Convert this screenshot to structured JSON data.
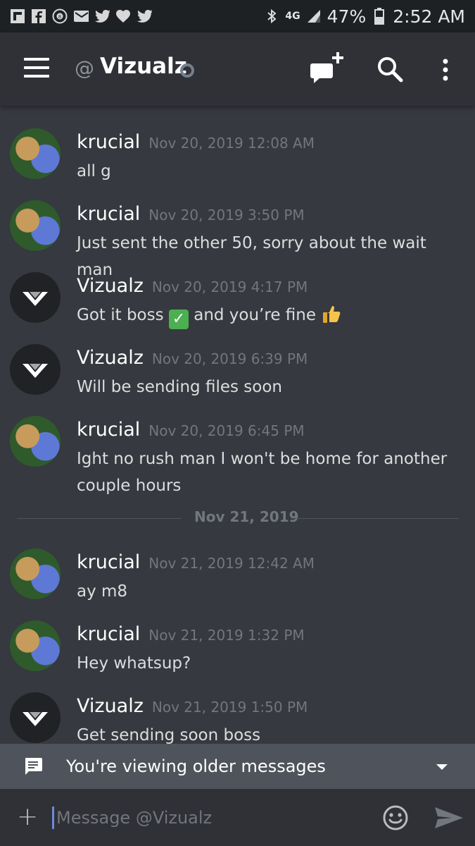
{
  "status_bar": {
    "left_icons": [
      "flipboard-icon",
      "facebook-icon",
      "8ball-icon",
      "mail-icon",
      "twitter-icon",
      "heart-icon",
      "twitter-icon"
    ],
    "network": "4G",
    "battery": "47%",
    "time": "2:52 AM"
  },
  "header": {
    "at_symbol": "@",
    "title": "Vizualz"
  },
  "messages": [
    {
      "author": "krucial",
      "timestamp": "Nov 20, 2019 12:08 AM",
      "text": "all g"
    },
    {
      "author": "krucial",
      "timestamp": "Nov 20, 2019 3:50 PM",
      "text": "Just sent the other 50, sorry about the wait man"
    },
    {
      "author": "Vizualz",
      "timestamp": "Nov 20, 2019 4:17 PM",
      "text_a": "Got it boss",
      "text_b": "and you’re fine"
    },
    {
      "author": "Vizualz",
      "timestamp": "Nov 20, 2019 6:39 PM",
      "text": "Will be sending files soon"
    },
    {
      "author": "krucial",
      "timestamp": "Nov 20, 2019 6:45 PM",
      "text": "Ight no rush man I won't be home for another couple hours"
    },
    {
      "author": "krucial",
      "timestamp": "Nov 21, 2019 12:42 AM",
      "text": "ay m8"
    },
    {
      "author": "krucial",
      "timestamp": "Nov 21, 2019 1:32 PM",
      "text": "Hey whatsup?"
    },
    {
      "author": "Vizualz",
      "timestamp": "Nov 21, 2019 1:50 PM",
      "text": "Get sending soon boss"
    }
  ],
  "date_divider": "Nov 21, 2019",
  "older_banner": {
    "text": "You're viewing older messages"
  },
  "composer": {
    "placeholder": "Message @Vizualz"
  },
  "colors": {
    "background": "#36393f",
    "header": "#2f3136",
    "accent": "#7289da",
    "banner": "#4f545c"
  }
}
